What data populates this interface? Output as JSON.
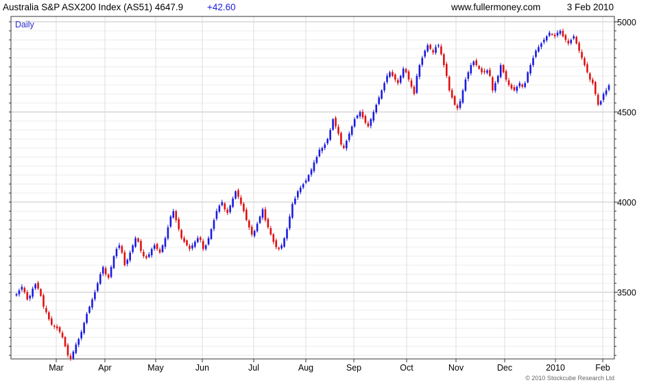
{
  "header": {
    "title": "Australia S&P ASX200 Index (AS51) 4647.9",
    "change": "+42.60",
    "site": "www.fullermoney.com",
    "date": "3 Feb 2010"
  },
  "chart_label": "Daily",
  "copyright": "© 2010 Stockcube Research Ltd",
  "colors": {
    "up": "#1a1adf",
    "down": "#e01010",
    "label": "#2a2acc",
    "grid": "#d4d4d4"
  },
  "chart_data": {
    "type": "candlestick",
    "title": "Australia S&P ASX200 Index (AS51) 4647.9 +42.60",
    "frequency": "Daily",
    "ylim": [
      3130,
      5030
    ],
    "y_ticks": [
      3500,
      4000,
      4500,
      5000
    ],
    "x_tick_labels": [
      "Mar",
      "Apr",
      "May",
      "Jun",
      "Jul",
      "Aug",
      "Sep",
      "Oct",
      "Nov",
      "Dec",
      "2010",
      "Feb"
    ],
    "grid": true,
    "last_close": 4647.9,
    "change": 42.6,
    "close_series_approx": [
      3490,
      3510,
      3530,
      3500,
      3460,
      3480,
      3520,
      3545,
      3520,
      3480,
      3420,
      3390,
      3350,
      3320,
      3310,
      3300,
      3280,
      3250,
      3200,
      3150,
      3130,
      3170,
      3210,
      3240,
      3280,
      3330,
      3380,
      3420,
      3460,
      3500,
      3550,
      3600,
      3640,
      3600,
      3580,
      3640,
      3700,
      3740,
      3760,
      3720,
      3650,
      3680,
      3720,
      3760,
      3800,
      3780,
      3730,
      3700,
      3690,
      3710,
      3740,
      3760,
      3740,
      3720,
      3760,
      3800,
      3860,
      3920,
      3950,
      3900,
      3850,
      3800,
      3780,
      3760,
      3740,
      3760,
      3780,
      3800,
      3790,
      3740,
      3760,
      3800,
      3850,
      3900,
      3950,
      3980,
      4000,
      3960,
      3940,
      3980,
      4020,
      4060,
      4030,
      3990,
      3950,
      3900,
      3860,
      3820,
      3840,
      3880,
      3920,
      3960,
      3900,
      3860,
      3820,
      3780,
      3750,
      3740,
      3760,
      3800,
      3850,
      3920,
      3990,
      4020,
      4060,
      4080,
      4100,
      4120,
      4150,
      4180,
      4220,
      4250,
      4290,
      4300,
      4320,
      4350,
      4400,
      4460,
      4420,
      4380,
      4320,
      4300,
      4340,
      4380,
      4420,
      4460,
      4480,
      4500,
      4470,
      4440,
      4420,
      4460,
      4500,
      4540,
      4580,
      4620,
      4660,
      4700,
      4720,
      4700,
      4680,
      4660,
      4700,
      4740,
      4720,
      4680,
      4640,
      4600,
      4700,
      4760,
      4800,
      4840,
      4870,
      4850,
      4830,
      4860,
      4870,
      4820,
      4760,
      4700,
      4620,
      4580,
      4540,
      4520,
      4560,
      4620,
      4680,
      4720,
      4760,
      4780,
      4760,
      4740,
      4720,
      4720,
      4730,
      4700,
      4620,
      4660,
      4700,
      4760,
      4720,
      4680,
      4650,
      4630,
      4620,
      4640,
      4660,
      4640,
      4660,
      4720,
      4760,
      4800,
      4840,
      4860,
      4880,
      4900,
      4920,
      4940,
      4930,
      4920,
      4940,
      4950,
      4920,
      4900,
      4880,
      4900,
      4920,
      4880,
      4840,
      4800,
      4760,
      4720,
      4680,
      4660,
      4600,
      4540,
      4560,
      4600,
      4620,
      4647.9
    ]
  }
}
